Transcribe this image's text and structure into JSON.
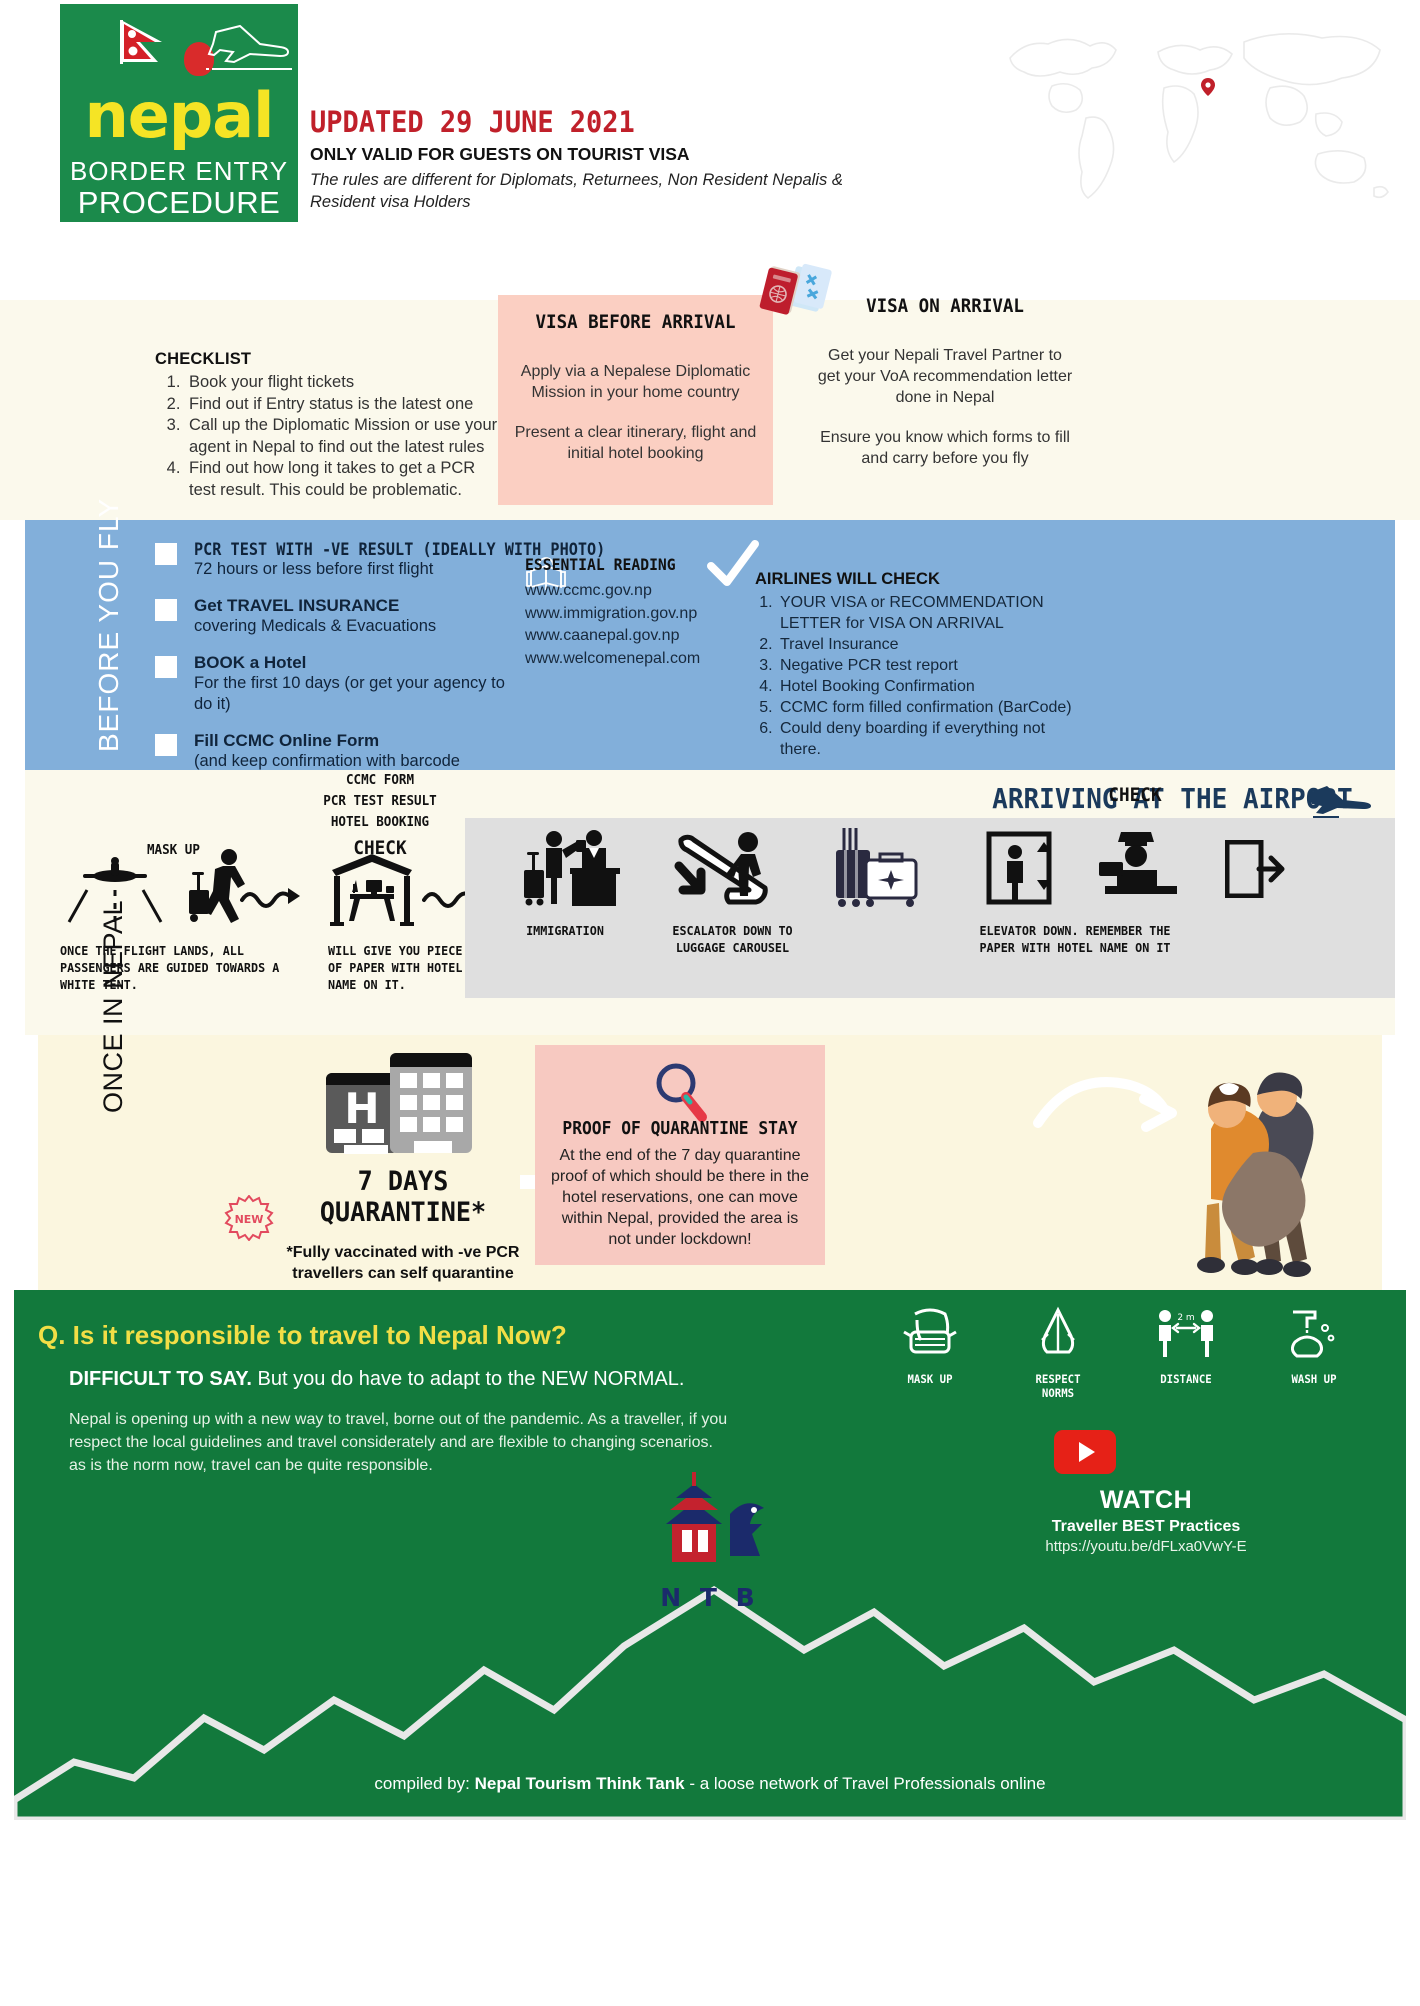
{
  "header": {
    "logo": {
      "wordmark": "nepal",
      "line1": "BORDER ENTRY",
      "line2": "PROCEDURE"
    },
    "updated": "UPDATED 29 JUNE 2021",
    "only_valid": "ONLY VALID FOR GUESTS ON TOURIST VISA",
    "rules_note": "The rules are different for Diplomats, Returnees, Non Resident Nepalis & Resident visa Holders"
  },
  "checklist": {
    "title": "CHECKLIST",
    "items": [
      "Book your flight tickets",
      "Find out if Entry status is the latest one",
      "Call up the Diplomatic Mission or use your agent in Nepal to find out the latest rules",
      "Find out how long it takes to get a PCR test result. This could be problematic."
    ]
  },
  "visa_before": {
    "title": "VISA BEFORE ARRIVAL",
    "p1": "Apply via a Nepalese Diplomatic Mission in your home country",
    "p2": "Present a clear itinerary, flight and initial hotel booking"
  },
  "visa_on_arrival": {
    "title": "VISA ON ARRIVAL",
    "p1": "Get your Nepali Travel Partner to get your VoA recommendation letter done in Nepal",
    "p2": "Ensure you know which forms to fill and carry before you fly"
  },
  "before_you_fly": {
    "vertical_label": "BEFORE YOU FLY",
    "checks": [
      {
        "title": "PCR TEST WITH -VE RESULT (IDEALLY WITH PHOTO)",
        "sub": "72 hours or less before first flight",
        "style": "condensed"
      },
      {
        "title": "Get TRAVEL INSURANCE",
        "sub": "covering Medicals & Evacuations",
        "style": "normal"
      },
      {
        "title": "BOOK a Hotel",
        "sub": "For the first 10 days (or get your agency to do it)",
        "style": "normal"
      },
      {
        "title": "Fill CCMC Online Form",
        "sub": "(and keep confirmation with barcode handy)",
        "style": "normal"
      }
    ],
    "reading": {
      "heading": "ESSENTIAL READING",
      "links": [
        "www.ccmc.gov.np",
        "www.immigration.gov.np",
        "www.caanepal.gov.np",
        "www.welcomenepal.com"
      ]
    },
    "airlines": {
      "heading": "AIRLINES WILL CHECK",
      "items": [
        "YOUR VISA or RECOMMENDATION LETTER for VISA ON ARRIVAL",
        "Travel Insurance",
        "Negative PCR test report",
        "Hotel Booking Confirmation",
        "CCMC form filled confirmation (BarCode)",
        "Could deny boarding if everything not there."
      ]
    }
  },
  "airport": {
    "heading": "ARRIVING AT THE AIRPORT",
    "mask_up": "MASK UP",
    "ccmc_stack": [
      "CCMC FORM",
      "PCR TEST RESULT",
      "HOTEL BOOKING"
    ],
    "check_label": "CHECK",
    "caption_plane": "ONCE THE FLIGHT LANDS, ALL PASSENGERS ARE GUIDED TOWARDS A WHITE TENT.",
    "caption_tent": "WILL GIVE YOU PIECE OF PAPER WITH HOTEL NAME ON IT.",
    "steps": [
      {
        "name": "immigration",
        "label": "IMMIGRATION"
      },
      {
        "name": "escalator",
        "label": "ESCALATOR DOWN TO LUGGAGE CAROUSEL"
      },
      {
        "name": "elevator",
        "label": "ELEVATOR DOWN. REMEMBER THE PAPER WITH HOTEL NAME ON IT"
      }
    ],
    "check_label2": "CHECK"
  },
  "once_in_nepal": {
    "vertical_label": "ONCE IN NEPAL",
    "badge": "NEW",
    "quarantine_line1": "7 DAYS",
    "quarantine_line2": "QUARANTINE*",
    "quarantine_note": "*Fully vaccinated with -ve PCR travellers can self quarantine",
    "proof": {
      "title": "PROOF OF QUARANTINE STAY",
      "body": "At the end of the 7 day quarantine proof of which should be there in the hotel reservations, one can move within Nepal, provided the area is not under lockdown!"
    }
  },
  "footer": {
    "question": "Q. Is it responsible to travel to Nepal Now?",
    "answer_bold": "DIFFICULT TO SAY.",
    "answer_rest": " But you do have to adapt to the NEW NORMAL.",
    "paragraph": "Nepal is opening up with a new way to travel, borne out of the pandemic. As a traveller, if you respect the local guidelines and travel considerately and are flexible to changing scenarios. as is the norm now, travel can be quite responsible.",
    "norms": [
      {
        "icon": "mask-face-icon",
        "label": "MASK UP"
      },
      {
        "icon": "namaste-hands-icon",
        "label": "RESPECT NORMS"
      },
      {
        "icon": "social-distance-icon",
        "label": "DISTANCE"
      },
      {
        "icon": "wash-hands-icon",
        "label": "WASH UP"
      }
    ],
    "watch": {
      "title": "WATCH",
      "subtitle": "Traveller BEST Practices",
      "url": "https://youtu.be/dFLxa0VwY-E"
    },
    "ntb": "N T B",
    "compiled_prefix": "compiled by:",
    "compiled_bold": "Nepal Tourism Think Tank",
    "compiled_suffix": " - a loose network of Travel Professionals online"
  },
  "colors": {
    "brand_green": "#12793C",
    "logo_yellow": "#F2DE46",
    "accent_red": "#C0202A",
    "band_blue": "#82AFDA",
    "band_pink": "#FBCFC2",
    "band_cream": "#FBF9EC"
  }
}
